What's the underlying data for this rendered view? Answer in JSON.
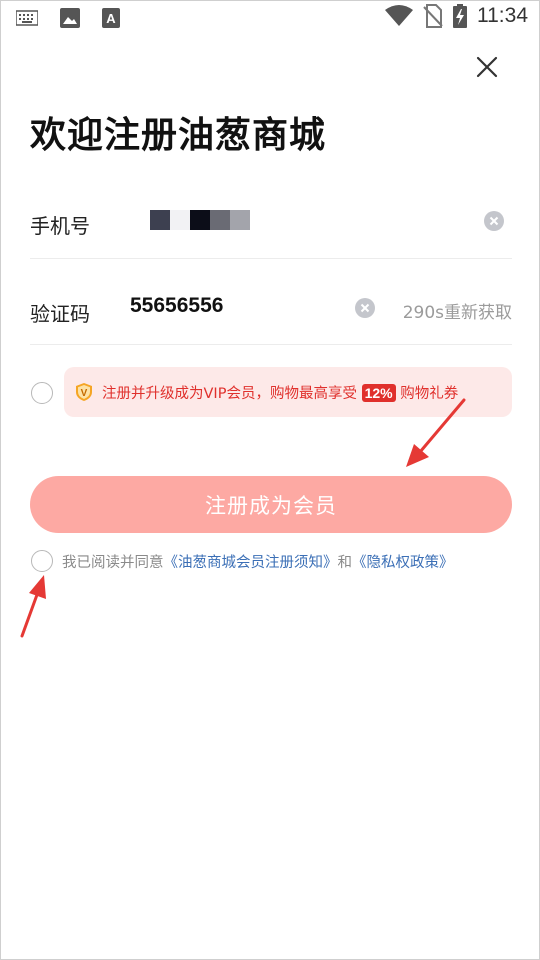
{
  "status_bar": {
    "time": "11:34",
    "icons": [
      "keyboard-icon",
      "image-icon",
      "font-icon",
      "wifi-icon",
      "no-sim-icon",
      "battery-charging-icon"
    ]
  },
  "page": {
    "title": "欢迎注册油葱商城"
  },
  "phone": {
    "label": "手机号",
    "value_masked": true
  },
  "code": {
    "label": "验证码",
    "value": "55656556",
    "resend": "290s重新获取"
  },
  "vip": {
    "text_before": "注册并升级成为VIP会员，购物最高享受",
    "badge": "12%",
    "text_after": "购物礼券"
  },
  "submit_label": "注册成为会员",
  "agreement": {
    "prefix": "我已阅读并同意",
    "link1": "《油葱商城会员注册须知》",
    "connector": "和",
    "link2": "《隐私权政策》"
  },
  "colors": {
    "accent": "#e0302c",
    "button": "#fda9a3",
    "banner_bg": "#fde9e8",
    "link": "#3b6fb6"
  }
}
